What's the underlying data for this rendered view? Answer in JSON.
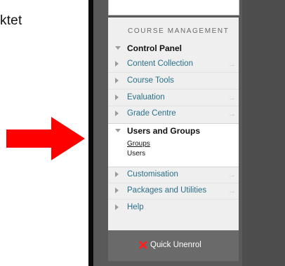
{
  "caption": {
    "text": "ktet"
  },
  "menu": {
    "section_title": "COURSE MANAGEMENT",
    "items": [
      {
        "label": "Control Panel",
        "state": "expanded",
        "bold": true,
        "arrow": ""
      },
      {
        "label": "Content Collection",
        "state": "collapsed",
        "arrow": "→"
      },
      {
        "label": "Course Tools",
        "state": "collapsed",
        "arrow": ""
      },
      {
        "label": "Evaluation",
        "state": "collapsed",
        "arrow": "→"
      },
      {
        "label": "Grade Centre",
        "state": "collapsed",
        "arrow": "→"
      },
      {
        "label": "Users and Groups",
        "state": "expanded",
        "bold": true,
        "arrow": ""
      },
      {
        "label": "Customisation",
        "state": "collapsed",
        "arrow": "→"
      },
      {
        "label": "Packages and Utilities",
        "state": "collapsed",
        "arrow": "→"
      },
      {
        "label": "Help",
        "state": "collapsed",
        "arrow": ""
      }
    ],
    "users_and_groups_children": [
      {
        "label": "Groups"
      },
      {
        "label": "Users"
      }
    ]
  },
  "quick_unenrol": {
    "label": "Quick Unenrol",
    "icon": "red-x-icon"
  },
  "colors": {
    "arrow": "#ff0000",
    "link": "#2a6f8a",
    "panel_dark": "#444444",
    "menu_bg": "#efefef"
  }
}
